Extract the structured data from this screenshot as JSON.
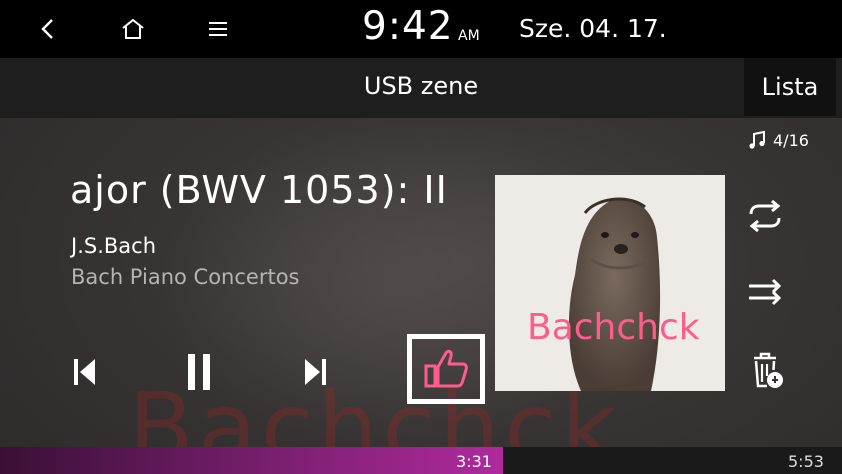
{
  "status": {
    "time": "9:42",
    "ampm": "AM",
    "date": "Sze. 04. 17."
  },
  "header": {
    "title": "USB zene",
    "list_label": "Lista"
  },
  "track": {
    "title": "ajor (BWV 1053): II",
    "artist": "J.S.Bach",
    "album": "Bach Piano Concertos",
    "counter": "4/16",
    "art_text": "Bachchck",
    "background_text": "Bachchck"
  },
  "progress": {
    "elapsed": "3:31",
    "total": "5:53",
    "fraction": 0.597
  },
  "icons": {
    "back": "back-icon",
    "home": "home-icon",
    "menu": "menu-icon",
    "note": "music-note-icon",
    "repeat": "repeat-icon",
    "shuffle": "shuffle-icon",
    "delete": "delete-playlist-icon",
    "prev": "previous-icon",
    "pause": "pause-icon",
    "next": "next-icon",
    "like": "thumbs-up-icon"
  },
  "colors": {
    "accent": "#b02a9e",
    "like": "#ff5c8e",
    "focus": "#b81b26"
  }
}
